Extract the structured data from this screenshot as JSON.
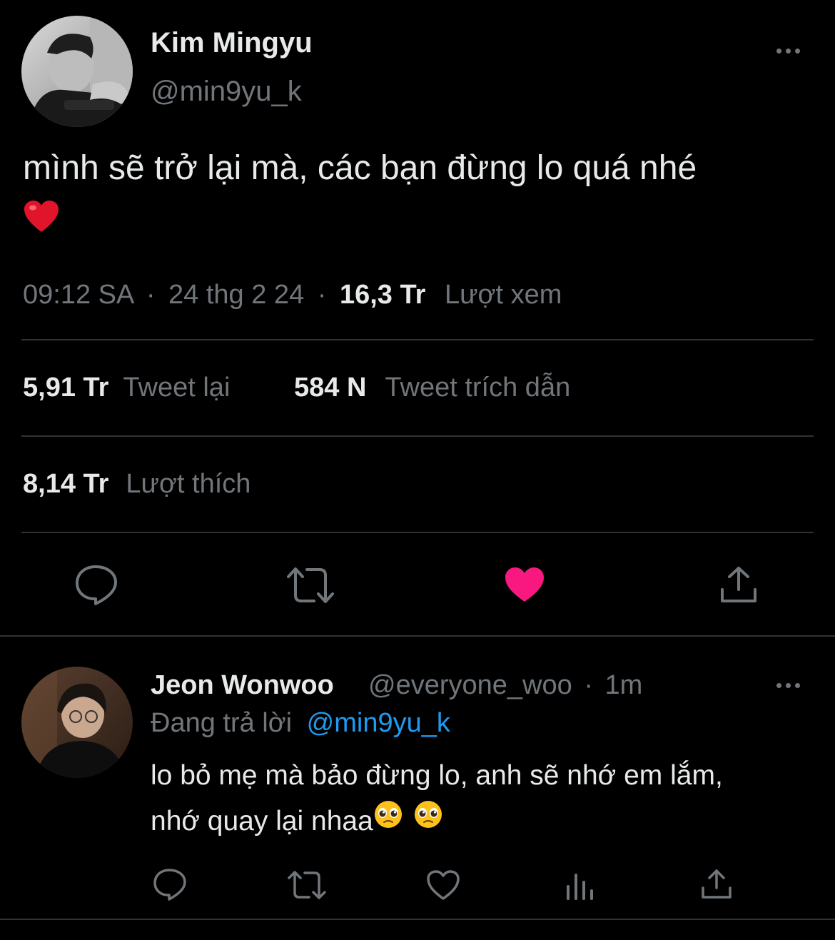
{
  "tweet": {
    "author_name": "Kim Mingyu",
    "author_handle": "@min9yu_k",
    "text": "mình sẽ trở lại mà, các bạn đừng lo quá nhé",
    "time": "09:12 SA",
    "date": "24 thg 2 24",
    "views_count": "16,3 Tr",
    "views_label": "Lượt xem",
    "separator": "·",
    "retweets_count": "5,91 Tr",
    "retweets_label": "Tweet lại",
    "quotes_count": "584 N",
    "quotes_label": "Tweet trích dẫn",
    "likes_count": "8,14 Tr",
    "likes_label": "Lượt thích",
    "liked": true
  },
  "reply": {
    "author_name": "Jeon Wonwoo",
    "author_handle": "@everyone_woo",
    "time": "1m",
    "replying_prefix": "Đang trả lời",
    "replying_to": "@min9yu_k",
    "line1": "lo bỏ mẹ mà bảo đừng lo, anh sẽ nhớ em lắm,",
    "line2": "nhớ quay lại nhaa"
  },
  "colors": {
    "background": "#000000",
    "text": "#e7e9ea",
    "secondary": "#71767b",
    "link": "#1d9bf0",
    "like": "#f91880",
    "divider": "#2f3336"
  },
  "icons": [
    "more-icon",
    "reply-icon",
    "retweet-icon",
    "like-icon",
    "share-icon",
    "analytics-icon",
    "heart-emoji",
    "pleading-face-emoji"
  ]
}
